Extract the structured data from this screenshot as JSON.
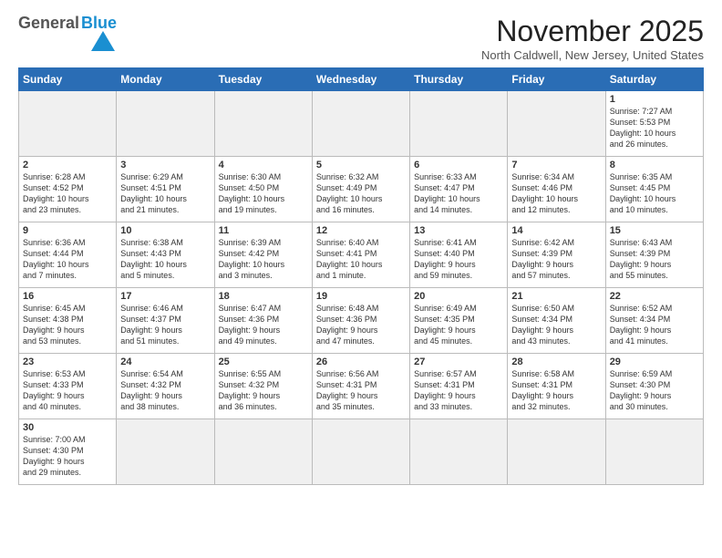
{
  "logo": {
    "general": "General",
    "blue": "Blue"
  },
  "title": "November 2025",
  "subtitle": "North Caldwell, New Jersey, United States",
  "weekdays": [
    "Sunday",
    "Monday",
    "Tuesday",
    "Wednesday",
    "Thursday",
    "Friday",
    "Saturday"
  ],
  "weeks": [
    [
      {
        "day": "",
        "empty": true
      },
      {
        "day": "",
        "empty": true
      },
      {
        "day": "",
        "empty": true
      },
      {
        "day": "",
        "empty": true
      },
      {
        "day": "",
        "empty": true
      },
      {
        "day": "",
        "empty": true
      },
      {
        "day": "1",
        "info": "Sunrise: 7:27 AM\nSunset: 5:53 PM\nDaylight: 10 hours\nand 26 minutes."
      }
    ],
    [
      {
        "day": "2",
        "info": "Sunrise: 6:28 AM\nSunset: 4:52 PM\nDaylight: 10 hours\nand 23 minutes."
      },
      {
        "day": "3",
        "info": "Sunrise: 6:29 AM\nSunset: 4:51 PM\nDaylight: 10 hours\nand 21 minutes."
      },
      {
        "day": "4",
        "info": "Sunrise: 6:30 AM\nSunset: 4:50 PM\nDaylight: 10 hours\nand 19 minutes."
      },
      {
        "day": "5",
        "info": "Sunrise: 6:32 AM\nSunset: 4:49 PM\nDaylight: 10 hours\nand 16 minutes."
      },
      {
        "day": "6",
        "info": "Sunrise: 6:33 AM\nSunset: 4:47 PM\nDaylight: 10 hours\nand 14 minutes."
      },
      {
        "day": "7",
        "info": "Sunrise: 6:34 AM\nSunset: 4:46 PM\nDaylight: 10 hours\nand 12 minutes."
      },
      {
        "day": "8",
        "info": "Sunrise: 6:35 AM\nSunset: 4:45 PM\nDaylight: 10 hours\nand 10 minutes."
      }
    ],
    [
      {
        "day": "9",
        "info": "Sunrise: 6:36 AM\nSunset: 4:44 PM\nDaylight: 10 hours\nand 7 minutes."
      },
      {
        "day": "10",
        "info": "Sunrise: 6:38 AM\nSunset: 4:43 PM\nDaylight: 10 hours\nand 5 minutes."
      },
      {
        "day": "11",
        "info": "Sunrise: 6:39 AM\nSunset: 4:42 PM\nDaylight: 10 hours\nand 3 minutes."
      },
      {
        "day": "12",
        "info": "Sunrise: 6:40 AM\nSunset: 4:41 PM\nDaylight: 10 hours\nand 1 minute."
      },
      {
        "day": "13",
        "info": "Sunrise: 6:41 AM\nSunset: 4:40 PM\nDaylight: 9 hours\nand 59 minutes."
      },
      {
        "day": "14",
        "info": "Sunrise: 6:42 AM\nSunset: 4:39 PM\nDaylight: 9 hours\nand 57 minutes."
      },
      {
        "day": "15",
        "info": "Sunrise: 6:43 AM\nSunset: 4:39 PM\nDaylight: 9 hours\nand 55 minutes."
      }
    ],
    [
      {
        "day": "16",
        "info": "Sunrise: 6:45 AM\nSunset: 4:38 PM\nDaylight: 9 hours\nand 53 minutes."
      },
      {
        "day": "17",
        "info": "Sunrise: 6:46 AM\nSunset: 4:37 PM\nDaylight: 9 hours\nand 51 minutes."
      },
      {
        "day": "18",
        "info": "Sunrise: 6:47 AM\nSunset: 4:36 PM\nDaylight: 9 hours\nand 49 minutes."
      },
      {
        "day": "19",
        "info": "Sunrise: 6:48 AM\nSunset: 4:36 PM\nDaylight: 9 hours\nand 47 minutes."
      },
      {
        "day": "20",
        "info": "Sunrise: 6:49 AM\nSunset: 4:35 PM\nDaylight: 9 hours\nand 45 minutes."
      },
      {
        "day": "21",
        "info": "Sunrise: 6:50 AM\nSunset: 4:34 PM\nDaylight: 9 hours\nand 43 minutes."
      },
      {
        "day": "22",
        "info": "Sunrise: 6:52 AM\nSunset: 4:34 PM\nDaylight: 9 hours\nand 41 minutes."
      }
    ],
    [
      {
        "day": "23",
        "info": "Sunrise: 6:53 AM\nSunset: 4:33 PM\nDaylight: 9 hours\nand 40 minutes."
      },
      {
        "day": "24",
        "info": "Sunrise: 6:54 AM\nSunset: 4:32 PM\nDaylight: 9 hours\nand 38 minutes."
      },
      {
        "day": "25",
        "info": "Sunrise: 6:55 AM\nSunset: 4:32 PM\nDaylight: 9 hours\nand 36 minutes."
      },
      {
        "day": "26",
        "info": "Sunrise: 6:56 AM\nSunset: 4:31 PM\nDaylight: 9 hours\nand 35 minutes."
      },
      {
        "day": "27",
        "info": "Sunrise: 6:57 AM\nSunset: 4:31 PM\nDaylight: 9 hours\nand 33 minutes."
      },
      {
        "day": "28",
        "info": "Sunrise: 6:58 AM\nSunset: 4:31 PM\nDaylight: 9 hours\nand 32 minutes."
      },
      {
        "day": "29",
        "info": "Sunrise: 6:59 AM\nSunset: 4:30 PM\nDaylight: 9 hours\nand 30 minutes."
      }
    ],
    [
      {
        "day": "30",
        "info": "Sunrise: 7:00 AM\nSunset: 4:30 PM\nDaylight: 9 hours\nand 29 minutes."
      },
      {
        "day": "",
        "empty": true
      },
      {
        "day": "",
        "empty": true
      },
      {
        "day": "",
        "empty": true
      },
      {
        "day": "",
        "empty": true
      },
      {
        "day": "",
        "empty": true
      },
      {
        "day": "",
        "empty": true
      }
    ]
  ]
}
